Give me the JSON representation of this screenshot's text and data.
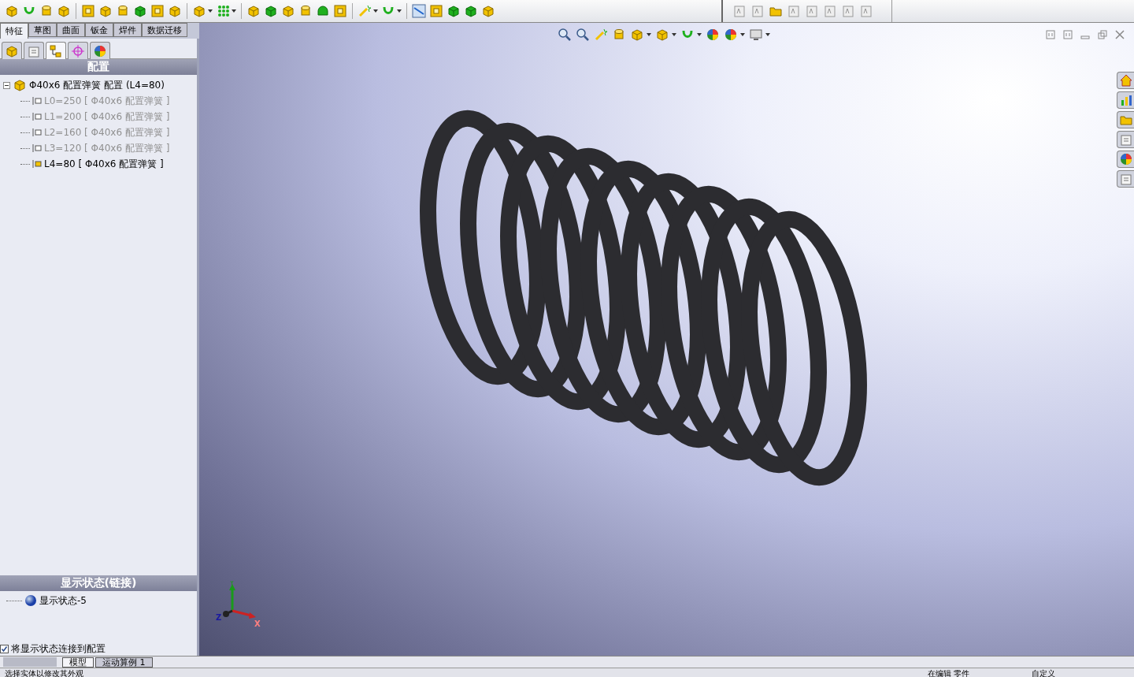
{
  "feature_tabs": [
    {
      "label": "特征",
      "selected": true
    },
    {
      "label": "草图",
      "selected": false
    },
    {
      "label": "曲面",
      "selected": false
    },
    {
      "label": "钣金",
      "selected": false
    },
    {
      "label": "焊件",
      "selected": false
    },
    {
      "label": "数据迁移",
      "selected": false
    }
  ],
  "panel_tabs": [
    {
      "kind": "part",
      "selected": false
    },
    {
      "kind": "property",
      "selected": false
    },
    {
      "kind": "config",
      "selected": true
    },
    {
      "kind": "target",
      "selected": false
    },
    {
      "kind": "appearance",
      "selected": false
    }
  ],
  "config_panel": {
    "title": "配置",
    "root": {
      "label": "Φ40x6 配置弹簧 配置  (L4=80)",
      "expanded": true,
      "children": [
        {
          "label": "L0=250 [ Φ40x6 配置弹簧 ]",
          "active": false
        },
        {
          "label": "L1=200 [ Φ40x6 配置弹簧 ]",
          "active": false
        },
        {
          "label": "L2=160 [ Φ40x6 配置弹簧 ]",
          "active": false
        },
        {
          "label": "L3=120 [ Φ40x6 配置弹簧 ]",
          "active": false
        },
        {
          "label": "L4=80 [ Φ40x6 配置弹簧 ]",
          "active": true
        }
      ]
    }
  },
  "display_state_panel": {
    "title": "显示状态(链接)",
    "items": [
      {
        "label": "显示状态-5"
      }
    ],
    "link_checkbox": {
      "label": "将显示状态连接到配置",
      "checked": true
    }
  },
  "triad": {
    "x": "X",
    "y": "Y",
    "z": "Z"
  },
  "bottom_tabs": [
    {
      "label": "模型",
      "selected": true
    },
    {
      "label": "运动算例 1",
      "selected": false
    }
  ],
  "status_bar": [
    "选择实体以修改其外观",
    "在编辑 零件",
    "自定义"
  ]
}
